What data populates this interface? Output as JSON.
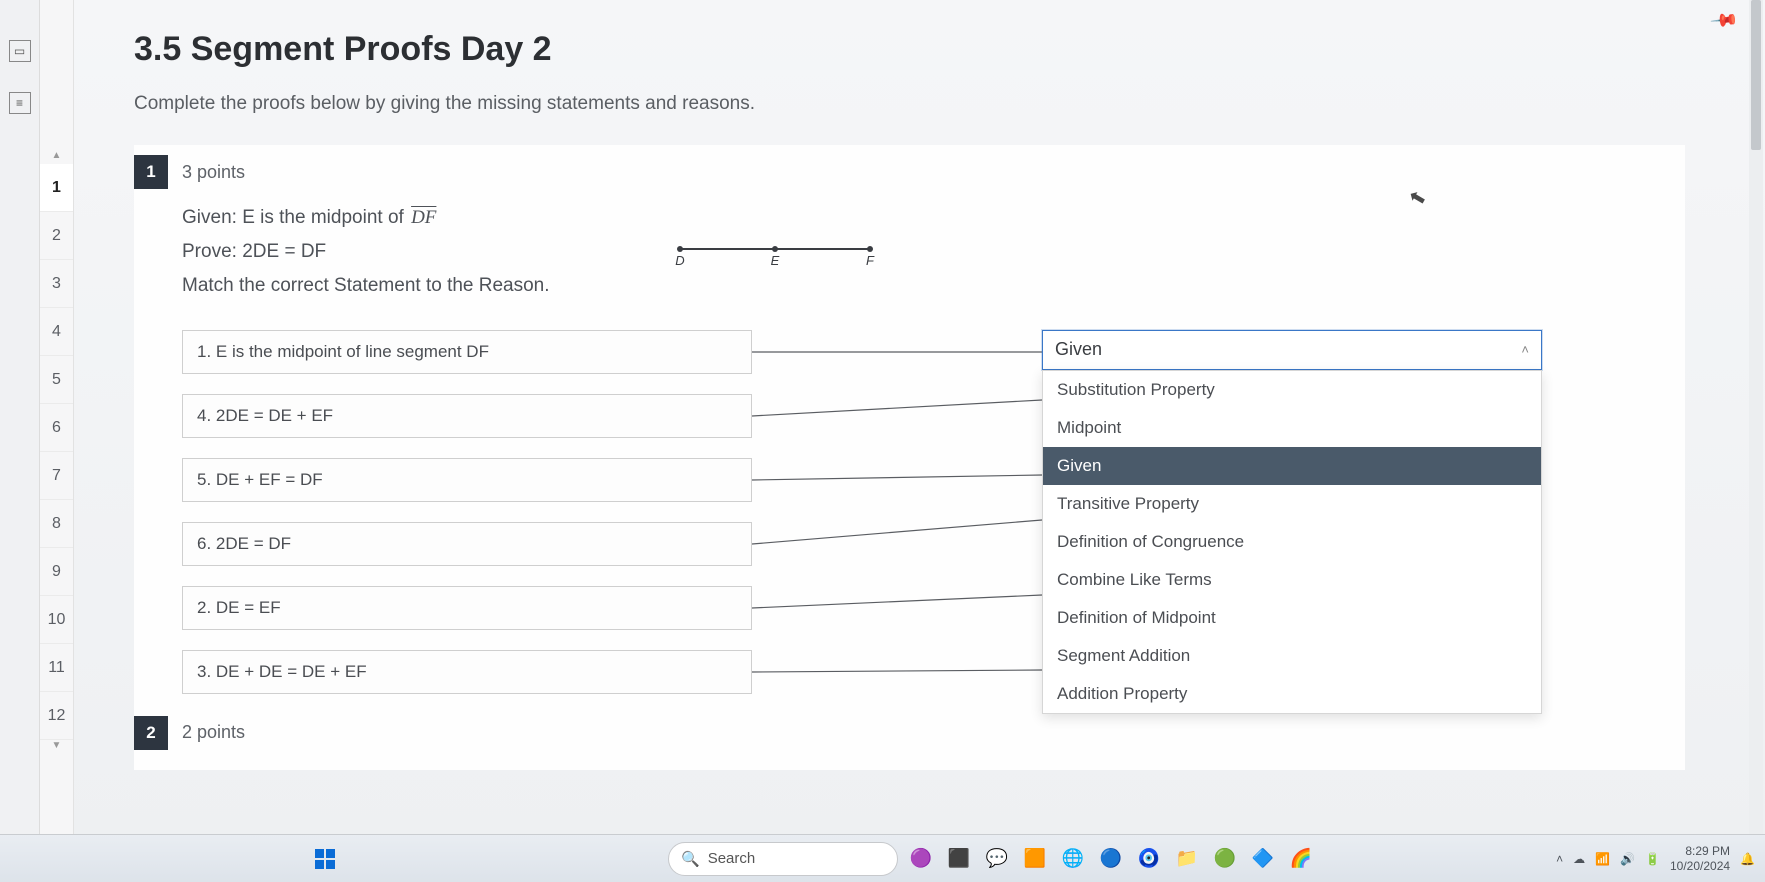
{
  "title": "3.5 Segment Proofs Day 2",
  "instructions": "Complete the proofs below by giving the missing statements and reasons.",
  "qnav": {
    "items": [
      "1",
      "2",
      "3",
      "4",
      "5",
      "6",
      "7",
      "8",
      "9",
      "10",
      "11",
      "12"
    ],
    "active": 0
  },
  "question1": {
    "number": "1",
    "points": "3 points",
    "given_label": "Given:",
    "given_text": "E is the midpoint of ",
    "given_seg": "DF",
    "prove_label": "Prove:",
    "prove_text": "2DE = DF",
    "match_instr": "Match the correct Statement to the Reason.",
    "diagram": {
      "points": [
        "D",
        "E",
        "F"
      ]
    },
    "statements": [
      "1. E is the midpoint of line segment DF",
      "4. 2DE = DE + EF",
      "5. DE + EF = DF",
      "6. 2DE = DF",
      "2. DE = EF",
      "3. DE + DE = DE + EF"
    ],
    "combo_value": "Given",
    "dropdown_options": [
      "Substitution Property",
      "Midpoint",
      "Given",
      "Transitive Property",
      "Definition of Congruence",
      "Combine Like Terms",
      "Definition of Midpoint",
      "Segment Addition",
      "Addition Property"
    ],
    "dropdown_selected_index": 2
  },
  "question2": {
    "number": "2",
    "points": "2 points"
  },
  "taskbar": {
    "search_placeholder": "Search",
    "time": "8:29 PM",
    "date": "10/20/2024"
  }
}
